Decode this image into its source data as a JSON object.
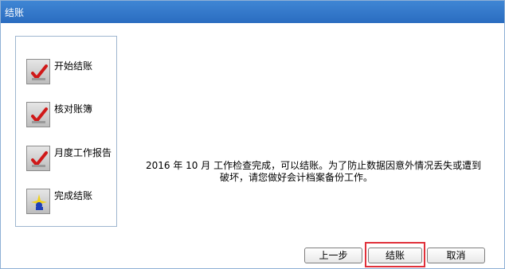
{
  "window": {
    "title": "结账"
  },
  "steps": [
    {
      "label": "开始结账",
      "icon": "red-check-icon"
    },
    {
      "label": "核对账簿",
      "icon": "red-check-icon"
    },
    {
      "label": "月度工作报告",
      "icon": "red-check-icon"
    },
    {
      "label": "完成结账",
      "icon": "current-step-sparkle-icon"
    }
  ],
  "message": {
    "line1": "2016 年 10 月  工作检查完成，可以结账。为了防止数据因意外情况丢失或遭到",
    "line2": "破坏，请您做好会计档案备份工作。"
  },
  "buttons": {
    "prev": "上一步",
    "finish": "结账",
    "cancel": "取消"
  },
  "colors": {
    "titlebar": "#2a6cc0",
    "highlight": "#e0303a",
    "check": "#d01818"
  }
}
